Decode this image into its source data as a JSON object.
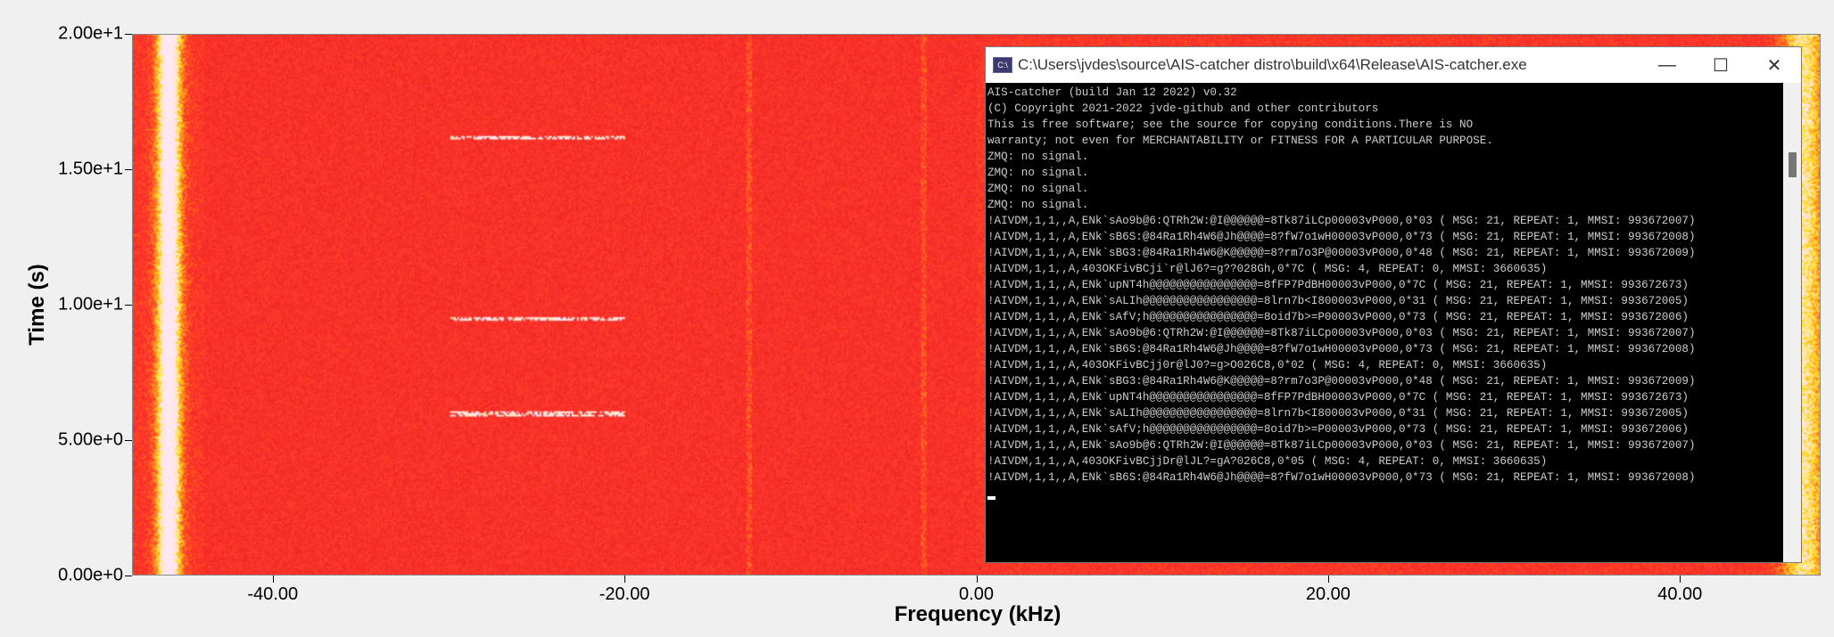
{
  "chart_data": {
    "type": "heatmap",
    "xlabel": "Frequency (kHz)",
    "ylabel": "Time (s)",
    "xlim": [
      -48,
      48
    ],
    "ylim": [
      0,
      20
    ],
    "xticks": [
      {
        "value": -40,
        "label": "-40.00"
      },
      {
        "value": -20,
        "label": "-20.00"
      },
      {
        "value": 0,
        "label": "0.00"
      },
      {
        "value": 20,
        "label": "20.00"
      },
      {
        "value": 40,
        "label": "40.00"
      }
    ],
    "yticks": [
      {
        "value": 0,
        "label": "0.00e+0"
      },
      {
        "value": 5,
        "label": "5.00e+0"
      },
      {
        "value": 10,
        "label": "1.00e+1"
      },
      {
        "value": 15,
        "label": "1.50e+1"
      },
      {
        "value": 20,
        "label": "2.00e+1"
      }
    ],
    "bright_bands_khz": [
      -46,
      47
    ],
    "bursts": [
      {
        "t": 6.0,
        "f_from": -30,
        "f_to": -20
      },
      {
        "t": 9.5,
        "f_from": -30,
        "f_to": -20
      },
      {
        "t": 16.2,
        "f_from": -30,
        "f_to": -20
      }
    ],
    "colors": {
      "background": "#e8231a",
      "high": "#ffe040"
    }
  },
  "console": {
    "title": "C:\\Users\\jvdes\\source\\AIS-catcher distro\\build\\x64\\Release\\AIS-catcher.exe",
    "icon_label": "C:\\",
    "minimize": "—",
    "maximize": "☐",
    "close": "✕",
    "lines": [
      "AIS-catcher (build Jan 12 2022) v0.32",
      "(C) Copyright 2021-2022 jvde-github and other contributors",
      "This is free software; see the source for copying conditions.There is NO",
      "warranty; not even for MERCHANTABILITY or FITNESS FOR A PARTICULAR PURPOSE.",
      "ZMQ: no signal.",
      "ZMQ: no signal.",
      "ZMQ: no signal.",
      "ZMQ: no signal.",
      "!AIVDM,1,1,,A,ENk`sAo9b@6:QTRh2W:@I@@@@@@=8Tk87iLCp00003vP000,0*03 ( MSG: 21, REPEAT: 1, MMSI: 993672007)",
      "!AIVDM,1,1,,A,ENk`sB6S:@84Ra1Rh4W6@Jh@@@@=8?fW7o1wH00003vP000,0*73 ( MSG: 21, REPEAT: 1, MMSI: 993672008)",
      "!AIVDM,1,1,,A,ENk`sBG3:@84Ra1Rh4W6@K@@@@@=8?rm7o3P@00003vP000,0*48 ( MSG: 21, REPEAT: 1, MMSI: 993672009)",
      "!AIVDM,1,1,,A,403OKFivBCji`r@lJ6?=g??028Gh,0*7C ( MSG: 4, REPEAT: 0, MMSI: 3660635)",
      "!AIVDM,1,1,,A,ENk`upNT4h@@@@@@@@@@@@@@@@=8fFP7PdBH00003vP000,0*7C ( MSG: 21, REPEAT: 1, MMSI: 993672673)",
      "!AIVDM,1,1,,A,ENk`sALIh@@@@@@@@@@@@@@@@@=8lrn7b<I800003vP000,0*31 ( MSG: 21, REPEAT: 1, MMSI: 993672005)",
      "!AIVDM,1,1,,A,ENk`sAfV;h@@@@@@@@@@@@@@@@=8oid7b>=P00003vP000,0*73 ( MSG: 21, REPEAT: 1, MMSI: 993672006)",
      "!AIVDM,1,1,,A,ENk`sAo9b@6:QTRh2W:@I@@@@@@=8Tk87iLCp00003vP000,0*03 ( MSG: 21, REPEAT: 1, MMSI: 993672007)",
      "!AIVDM,1,1,,A,ENk`sB6S:@84Ra1Rh4W6@Jh@@@@=8?fW7o1wH00003vP000,0*73 ( MSG: 21, REPEAT: 1, MMSI: 993672008)",
      "!AIVDM,1,1,,A,403OKFivBCjj0r@lJ0?=g>O026C8,0*02 ( MSG: 4, REPEAT: 0, MMSI: 3660635)",
      "!AIVDM,1,1,,A,ENk`sBG3:@84Ra1Rh4W6@K@@@@@=8?rm7o3P@00003vP000,0*48 ( MSG: 21, REPEAT: 1, MMSI: 993672009)",
      "!AIVDM,1,1,,A,ENk`upNT4h@@@@@@@@@@@@@@@@=8fFP7PdBH00003vP000,0*7C ( MSG: 21, REPEAT: 1, MMSI: 993672673)",
      "!AIVDM,1,1,,A,ENk`sALIh@@@@@@@@@@@@@@@@@=8lrn7b<I800003vP000,0*31 ( MSG: 21, REPEAT: 1, MMSI: 993672005)",
      "!AIVDM,1,1,,A,ENk`sAfV;h@@@@@@@@@@@@@@@@=8oid7b>=P00003vP000,0*73 ( MSG: 21, REPEAT: 1, MMSI: 993672006)",
      "!AIVDM,1,1,,A,ENk`sAo9b@6:QTRh2W:@I@@@@@@=8Tk87iLCp00003vP000,0*03 ( MSG: 21, REPEAT: 1, MMSI: 993672007)",
      "!AIVDM,1,1,,A,403OKFivBCjjDr@lJL?=gA?026C8,0*05 ( MSG: 4, REPEAT: 0, MMSI: 3660635)",
      "!AIVDM,1,1,,A,ENk`sB6S:@84Ra1Rh4W6@Jh@@@@=8?fW7o1wH00003vP000,0*73 ( MSG: 21, REPEAT: 1, MMSI: 993672008)"
    ]
  }
}
